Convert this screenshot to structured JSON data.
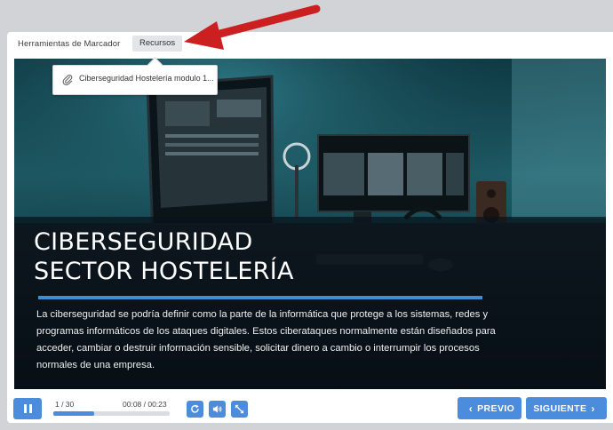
{
  "topbar": {
    "bookmarks_tab": "Herramientas de Marcador",
    "resources_tab": "Recursos"
  },
  "resources_menu": {
    "items": [
      {
        "label": "Ciberseguridad Hostelería modulo 1...",
        "icon": "paperclip-icon"
      }
    ]
  },
  "slide": {
    "title": "CIBERSEGURIDAD\nSECTOR HOSTELERÍA",
    "body": "La ciberseguridad se podría definir como la parte de la informática que protege a los sistemas, redes y programas informáticos de los ataques digitales. Estos ciberataques normalmente están diseñados para acceder, cambiar o destruir información sensible, solicitar dinero a cambio o interrumpir los procesos normales de una empresa.",
    "accent_color": "#3a8fd8"
  },
  "playback": {
    "slide_counter": "1 / 30",
    "time": "00:08 / 00:23",
    "progress_fraction": 0.35,
    "pause_icon": "pause-icon",
    "replay_icon": "replay-icon",
    "volume_icon": "volume-icon",
    "fullscreen_icon": "fullscreen-icon"
  },
  "navigation": {
    "prev_label": "PREVIO",
    "next_label": "SIGUIENTE"
  },
  "colors": {
    "accent": "#4b8ddc",
    "annotation_arrow": "#cc1f1f"
  }
}
